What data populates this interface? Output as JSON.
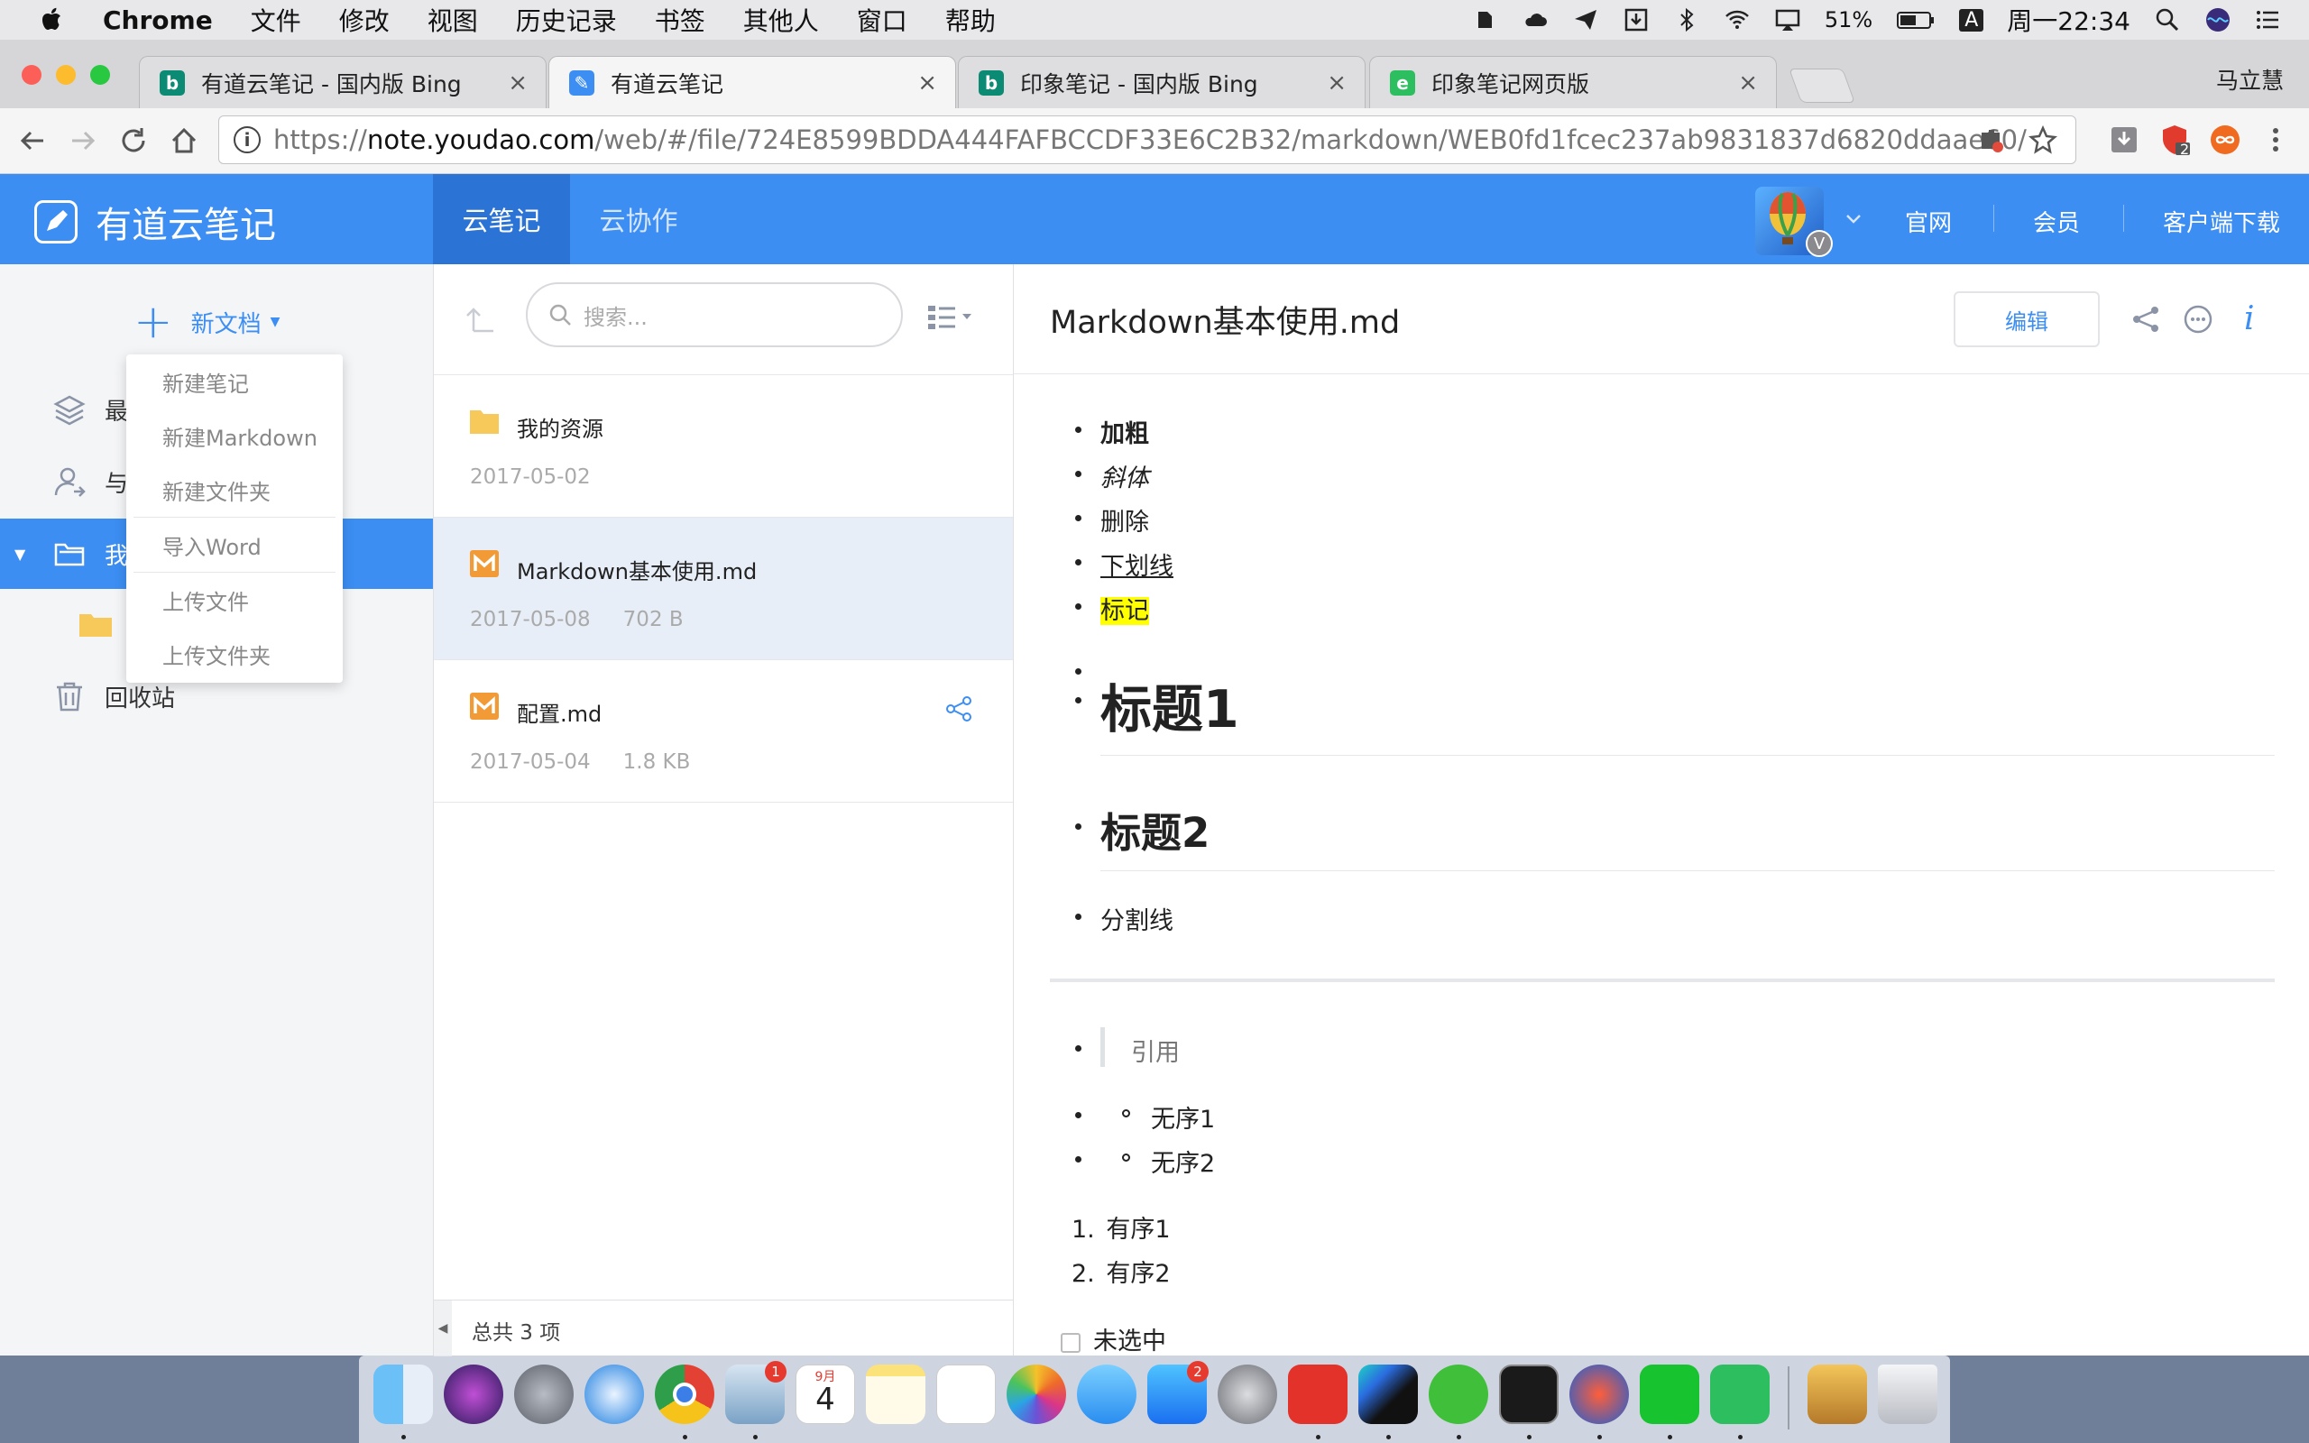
{
  "menubar": {
    "app_name": "Chrome",
    "items": [
      "文件",
      "修改",
      "视图",
      "历史记录",
      "书签",
      "其他人",
      "窗口",
      "帮助"
    ],
    "battery": "51%",
    "input_method": "A",
    "clock": "周一22:34"
  },
  "browser": {
    "tabs": [
      {
        "title": "有道云笔记 - 国内版 Bing",
        "favicon": "bing-icon",
        "active": false
      },
      {
        "title": "有道云笔记",
        "favicon": "youdao-note-icon",
        "active": true
      },
      {
        "title": "印象笔记 - 国内版 Bing",
        "favicon": "bing-icon",
        "active": false
      },
      {
        "title": "印象笔记网页版",
        "favicon": "evernote-icon",
        "active": false
      }
    ],
    "profile_name": "马立慧",
    "url_scheme": "https://",
    "url_host": "note.youdao.com",
    "url_path": "/web/#/file/724E8599BDDA444FAFBCCDF33E6C2B32/markdown/WEB0fd1fcec237ab9831837d6820ddaae60/",
    "extension_badge": "2"
  },
  "app": {
    "logo_text": "有道云笔记",
    "nav_tabs": [
      "云笔记",
      "云协作"
    ],
    "header_links": [
      "官网",
      "会员",
      "客户端下载"
    ],
    "avatar_badge": "V",
    "brand_color": "#3c8ef3"
  },
  "sidebar": {
    "new_doc_label": "新文档",
    "items": [
      {
        "label": "最",
        "icon": "layers-icon"
      },
      {
        "label": "与",
        "icon": "shared-user-icon"
      },
      {
        "label": "我",
        "icon": "folder-icon"
      },
      {
        "label": "回收站",
        "icon": "trash-icon"
      }
    ],
    "dropdown": [
      "新建笔记",
      "新建Markdown",
      "新建文件夹",
      "导入Word",
      "上传文件",
      "上传文件夹"
    ]
  },
  "filelist": {
    "search_placeholder": "搜索...",
    "files": [
      {
        "name": "我的资源",
        "date": "2017-05-02",
        "size": "",
        "type": "folder"
      },
      {
        "name": "Markdown基本使用.md",
        "date": "2017-05-08",
        "size": "702 B",
        "type": "markdown"
      },
      {
        "name": "配置.md",
        "date": "2017-05-04",
        "size": "1.8 KB",
        "type": "markdown"
      }
    ],
    "footer": "总共 3 项"
  },
  "editor": {
    "title": "Markdown基本使用.md",
    "edit_label": "编辑",
    "content": {
      "bold": "加粗",
      "italic": "斜体",
      "strike": "删除",
      "underline": "下划线",
      "mark": "标记",
      "h1": "标题1",
      "h2": "标题2",
      "hr_label": "分割线",
      "quote": "引用",
      "unordered": [
        "无序1",
        "无序2"
      ],
      "ordered": [
        "有序1",
        "有序2"
      ],
      "ordered_nums": [
        "1.",
        "2."
      ],
      "task": "未选中"
    }
  },
  "dock": {
    "badges": {
      "mail": "1",
      "calendar_month": "9月",
      "calendar_day": "4",
      "appstore": "2"
    }
  }
}
